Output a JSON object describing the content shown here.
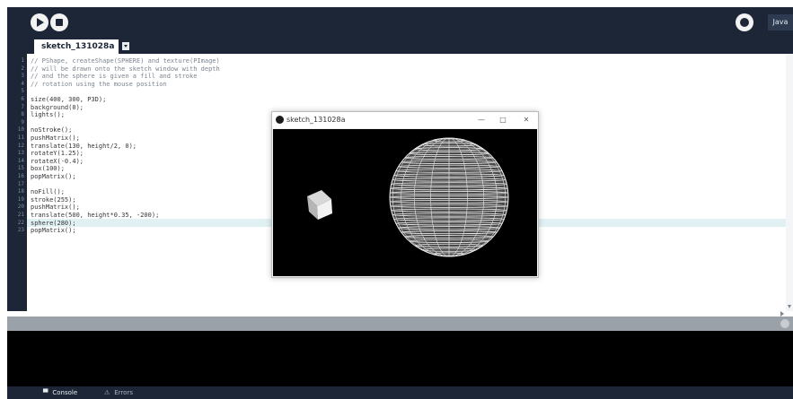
{
  "toolbar": {
    "run_icon": "play-icon",
    "stop_icon": "stop-icon",
    "mode_label": "Java"
  },
  "tabs": [
    {
      "label": "sketch_131028a"
    }
  ],
  "editor": {
    "lines": [
      {
        "n": "1",
        "text": "// PShape, createShape(SPHERE) and texture(PImage)",
        "kind": "comment"
      },
      {
        "n": "2",
        "text": "// will be drawn onto the sketch window with depth",
        "kind": "comment"
      },
      {
        "n": "3",
        "text": "// and the sphere is given a fill and stroke",
        "kind": "comment"
      },
      {
        "n": "4",
        "text": "// rotation using the mouse position",
        "kind": "comment"
      },
      {
        "n": "5",
        "text": "",
        "kind": "code"
      },
      {
        "n": "6",
        "text": "size(400, 300, P3D);",
        "kind": "code"
      },
      {
        "n": "7",
        "text": "background(0);",
        "kind": "code"
      },
      {
        "n": "8",
        "text": "lights();",
        "kind": "code"
      },
      {
        "n": "9",
        "text": "",
        "kind": "code"
      },
      {
        "n": "10",
        "text": "noStroke();",
        "kind": "code"
      },
      {
        "n": "11",
        "text": "pushMatrix();",
        "kind": "code"
      },
      {
        "n": "12",
        "text": "translate(130, height/2, 0);",
        "kind": "code"
      },
      {
        "n": "13",
        "text": "rotateY(1.25);",
        "kind": "code"
      },
      {
        "n": "14",
        "text": "rotateX(-0.4);",
        "kind": "code"
      },
      {
        "n": "15",
        "text": "box(100);",
        "kind": "code"
      },
      {
        "n": "16",
        "text": "popMatrix();",
        "kind": "code"
      },
      {
        "n": "17",
        "text": "",
        "kind": "code"
      },
      {
        "n": "18",
        "text": "noFill();",
        "kind": "code"
      },
      {
        "n": "19",
        "text": "stroke(255);",
        "kind": "code"
      },
      {
        "n": "20",
        "text": "pushMatrix();",
        "kind": "code"
      },
      {
        "n": "21",
        "text": "translate(500, height*0.35, -200);",
        "kind": "code"
      },
      {
        "n": "22",
        "text": "sphere(280);",
        "kind": "code"
      },
      {
        "n": "23",
        "text": "popMatrix();",
        "kind": "code"
      }
    ],
    "highlighted_line": "22"
  },
  "sketch_window": {
    "title": "sketch_131028a",
    "logo_icon": "processing-logo-icon",
    "minimize_glyph": "—",
    "maximize_glyph": "□",
    "close_glyph": "✕"
  },
  "bottom_tabs": [
    {
      "label": "Console",
      "icon": "console-icon"
    },
    {
      "label": "Errors",
      "icon": "warning-icon"
    }
  ],
  "colors": {
    "chrome": "#1c2636",
    "editor_bg": "#ffffff",
    "highlight_row": "#e1f1f3",
    "console_bg": "#000000",
    "status_bar": "#9aa1a9"
  }
}
